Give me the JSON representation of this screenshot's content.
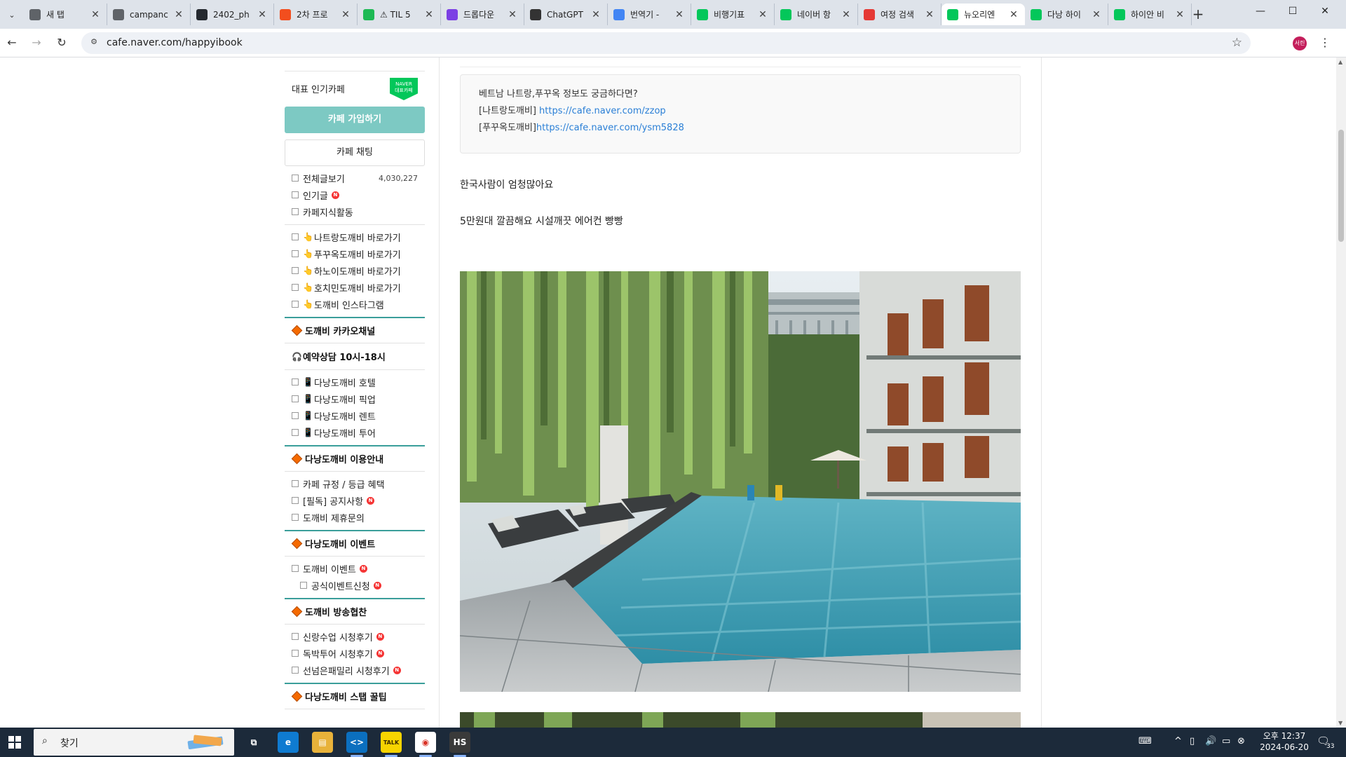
{
  "browser": {
    "tabs": [
      {
        "title": "새 탭",
        "favicon": "chrome-icon",
        "fav_color": "#5f6368"
      },
      {
        "title": "campanc",
        "favicon": "chrome-icon",
        "fav_color": "#5f6368"
      },
      {
        "title": "2402_ph",
        "favicon": "github-icon",
        "fav_color": "#24292f"
      },
      {
        "title": "2차 프로",
        "favicon": "figma-icon",
        "fav_color": "#f24e1e"
      },
      {
        "title": "⚠ TIL 5",
        "favicon": "v-icon",
        "fav_color": "#1db954"
      },
      {
        "title": "드롭다운",
        "favicon": "b-icon",
        "fav_color": "#7b3fe4"
      },
      {
        "title": "ChatGPT",
        "favicon": "openai-icon",
        "fav_color": "#333333"
      },
      {
        "title": "번역기 -",
        "favicon": "google-icon",
        "fav_color": "#4285f4"
      },
      {
        "title": "비행기표",
        "favicon": "naver-icon",
        "fav_color": "#03c75a"
      },
      {
        "title": "네이버 항",
        "favicon": "plane-icon",
        "fav_color": "#03c75a"
      },
      {
        "title": "여정 검색",
        "favicon": "pin-icon",
        "fav_color": "#e53935"
      },
      {
        "title": "뉴오리엔",
        "favicon": "cafe-icon",
        "fav_color": "#03c75a",
        "active": true
      },
      {
        "title": "다낭 하이",
        "favicon": "naver-icon",
        "fav_color": "#03c75a"
      },
      {
        "title": "하이안 비",
        "favicon": "cafe-icon",
        "fav_color": "#03c75a"
      }
    ],
    "url": "cafe.naver.com/happyibook",
    "profile_label": "서린"
  },
  "sidebar": {
    "rep_label": "대표 인기카페",
    "naver_badge_top": "NAVER",
    "naver_badge_bottom": "대표카페",
    "join_label": "카페 가입하기",
    "chat_label": "카페 채팅",
    "group1": [
      {
        "label": "전체글보기",
        "count": "4,030,227"
      },
      {
        "label": "인기글",
        "new": "N"
      },
      {
        "label": "카페지식활동"
      }
    ],
    "group2": [
      {
        "label": "나트랑도깨비 바로가기"
      },
      {
        "label": "푸꾸옥도깨비 바로가기"
      },
      {
        "label": "하노이도깨비 바로가기"
      },
      {
        "label": "호치민도깨비 바로가기"
      },
      {
        "label": "도깨비 인스타그램"
      }
    ],
    "section_kakao": "도깨비 카카오채널",
    "section_reserve": "예약상담 10시-18시",
    "group3": [
      {
        "label": "다낭도깨비 호텔"
      },
      {
        "label": "다낭도깨비 픽업"
      },
      {
        "label": "다낭도깨비 렌트"
      },
      {
        "label": "다낭도깨비 투어"
      }
    ],
    "section_guide": "다낭도깨비 이용안내",
    "group4": [
      {
        "label": "카페 규정 / 등급 혜택"
      },
      {
        "label": "[필독] 공지사항",
        "new": "N"
      },
      {
        "label": "도깨비 제휴문의"
      }
    ],
    "section_event": "다낭도깨비 이벤트",
    "group5": [
      {
        "label": "도깨비 이벤트",
        "new": "N"
      },
      {
        "label": "공식이벤트신청",
        "new": "N",
        "sub": true
      }
    ],
    "section_broadcast": "도깨비 방송협찬",
    "group6": [
      {
        "label": "신랑수업 시청후기",
        "new": "N"
      },
      {
        "label": "독박투어 시청후기",
        "new": "N"
      },
      {
        "label": "선넘은패밀리 시청후기",
        "new": "N"
      }
    ],
    "section_staff": "다낭도깨비 스탭 꿀팁"
  },
  "article": {
    "info_line1": "베트남 나트랑,푸꾸옥 정보도 궁금하다면?",
    "info_line2_label": "[나트랑도깨비]",
    "info_line2_link": "https://cafe.naver.com/zzop",
    "info_line3_label": "[푸꾸옥도깨비]",
    "info_line3_link": "https://cafe.naver.com/ysm5828",
    "para1": "한국사람이 엄청많아요",
    "para2": "5만원대 깔끔해요 시설깨끗 에어컨 빵빵"
  },
  "taskbar": {
    "search_text": "찾기",
    "apps": [
      {
        "name": "task-view-icon",
        "label": "⧉"
      },
      {
        "name": "edge-icon",
        "label": "e"
      },
      {
        "name": "file-explorer-icon",
        "label": "▤"
      },
      {
        "name": "vscode-icon",
        "label": "<>"
      },
      {
        "name": "kakaotalk-icon",
        "label": "TALK"
      },
      {
        "name": "chrome-icon",
        "label": "◉"
      },
      {
        "name": "hs-icon",
        "label": "HS"
      }
    ],
    "time": "오후 12:37",
    "date": "2024-06-20",
    "notification_count": "33"
  },
  "colors": {
    "accent_teal": "#7dc9c3",
    "section_line": "#3a9e9a",
    "link_blue": "#2a7fd6",
    "new_badge": "#f53535",
    "naver_green": "#03c75a"
  }
}
